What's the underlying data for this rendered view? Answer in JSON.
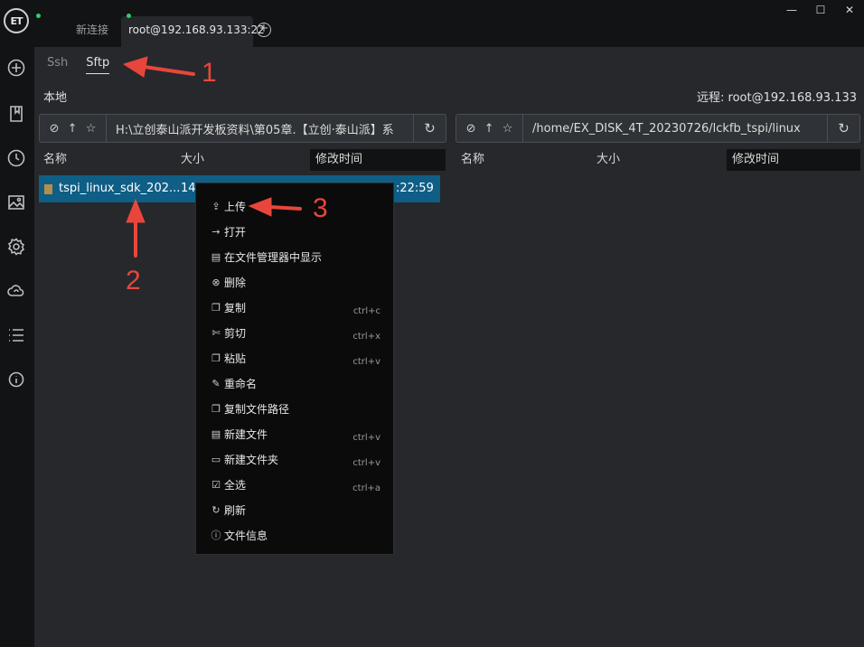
{
  "app": {
    "logo_text": "ET",
    "tabs": [
      {
        "label": "新连接"
      },
      {
        "label": "root@192.168.93.133:22"
      }
    ],
    "add_tab_symbol": "+",
    "window_buttons": {
      "minimize": "—",
      "maximize": "☐",
      "close": "✕"
    }
  },
  "sidebar": {
    "icons": [
      "plus-circle-icon",
      "bookmark-icon",
      "clock-icon",
      "image-icon",
      "gear-icon",
      "cloud-sync-icon",
      "list-icon",
      "info-icon"
    ]
  },
  "subtabs": [
    {
      "label": "Ssh"
    },
    {
      "label": "Sftp"
    }
  ],
  "local": {
    "title": "本地",
    "path": "H:\\立创泰山派开发板资料\\第05章.【立创·泰山派】系",
    "columns": {
      "name": "名称",
      "size": "大小",
      "modified": "修改时间"
    },
    "rows": [
      {
        "name": "tspi_linux_sdk_202...",
        "size": "14.",
        "modified": ":22:59"
      }
    ]
  },
  "remote": {
    "title": "远程: root@192.168.93.133",
    "path": "/home/EX_DISK_4T_20230726/lckfb_tspi/linux",
    "columns": {
      "name": "名称",
      "size": "大小",
      "modified": "修改时间"
    }
  },
  "context_menu": [
    {
      "icon": "upload-icon",
      "glyph": "⇪",
      "label": "上传",
      "shortcut": ""
    },
    {
      "icon": "arrow-right-icon",
      "glyph": "→",
      "label": "打开",
      "shortcut": ""
    },
    {
      "icon": "file-icon",
      "glyph": "▤",
      "label": "在文件管理器中显示",
      "shortcut": ""
    },
    {
      "icon": "delete-icon",
      "glyph": "⊗",
      "label": "删除",
      "shortcut": ""
    },
    {
      "icon": "copy-icon",
      "glyph": "❐",
      "label": "复制",
      "shortcut": "ctrl+c"
    },
    {
      "icon": "cut-icon",
      "glyph": "✄",
      "label": "剪切",
      "shortcut": "ctrl+x"
    },
    {
      "icon": "paste-icon",
      "glyph": "❐",
      "label": "粘贴",
      "shortcut": "ctrl+v"
    },
    {
      "icon": "rename-icon",
      "glyph": "✎",
      "label": "重命名",
      "shortcut": ""
    },
    {
      "icon": "copy-path-icon",
      "glyph": "❐",
      "label": "复制文件路径",
      "shortcut": ""
    },
    {
      "icon": "new-file-icon",
      "glyph": "▤",
      "label": "新建文件",
      "shortcut": "ctrl+v"
    },
    {
      "icon": "new-folder-icon",
      "glyph": "▭",
      "label": "新建文件夹",
      "shortcut": "ctrl+v"
    },
    {
      "icon": "select-all-icon",
      "glyph": "☑",
      "label": "全选",
      "shortcut": "ctrl+a"
    },
    {
      "icon": "refresh-icon",
      "glyph": "↻",
      "label": "刷新",
      "shortcut": ""
    },
    {
      "icon": "info-icon",
      "glyph": "ⓘ",
      "label": "文件信息",
      "shortcut": ""
    }
  ],
  "annotations": [
    "1",
    "2",
    "3"
  ],
  "colors": {
    "accent": "#0f5e86",
    "annotation": "#e8463c",
    "status_dot": "#2ecc71"
  }
}
